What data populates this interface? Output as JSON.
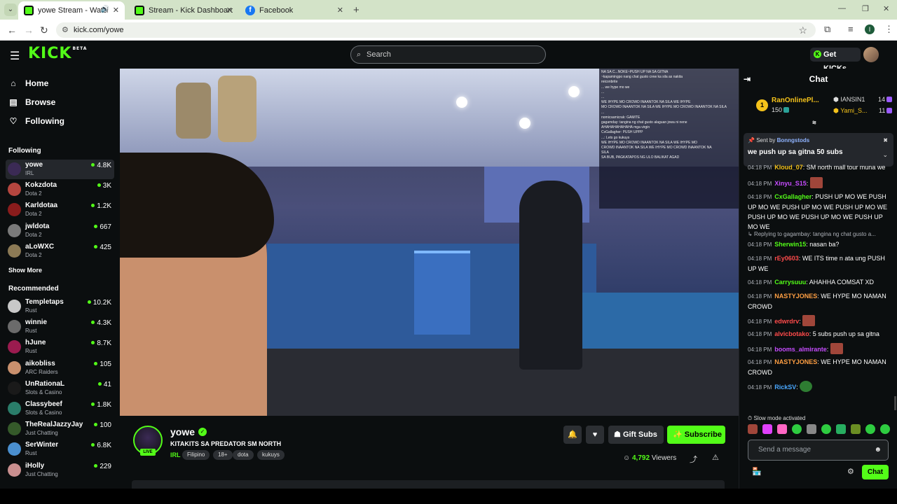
{
  "browser": {
    "tabs": [
      {
        "title": "yowe Stream - Watch Live o",
        "icon": "kick-favicon",
        "active": true
      },
      {
        "title": "Stream - Kick Dashboard",
        "icon": "kick-favicon",
        "active": false
      },
      {
        "title": "Facebook",
        "icon": "facebook-favicon",
        "active": false
      }
    ],
    "url": "kick.com/yowe",
    "profile_initial": "I"
  },
  "header": {
    "logo": "KICK",
    "logo_badge": "BETA",
    "search_placeholder": "Search",
    "get_kicks": "Get KICKs"
  },
  "sidebar": {
    "nav": [
      {
        "label": "Home",
        "icon": "home-icon"
      },
      {
        "label": "Browse",
        "icon": "browse-icon"
      },
      {
        "label": "Following",
        "icon": "heart-icon"
      }
    ],
    "following_title": "Following",
    "following": [
      {
        "name": "yowe",
        "category": "IRL",
        "viewers": "4.8K",
        "color": "#3b2a55"
      },
      {
        "name": "Kokzdota",
        "category": "Dota 2",
        "viewers": "3K",
        "color": "#b5463f"
      },
      {
        "name": "Karldotaa",
        "category": "Dota 2",
        "viewers": "1.2K",
        "color": "#8a1c1c"
      },
      {
        "name": "jwldota",
        "category": "Dota 2",
        "viewers": "667",
        "color": "#7a7a7a"
      },
      {
        "name": "aLoWXC",
        "category": "Dota 2",
        "viewers": "425",
        "color": "#8c7a55"
      }
    ],
    "show_more": "Show More",
    "recommended_title": "Recommended",
    "recommended": [
      {
        "name": "Templetaps",
        "category": "Rust",
        "viewers": "10.2K",
        "color": "#c8c8c8"
      },
      {
        "name": "winnie",
        "category": "Rust",
        "viewers": "4.3K",
        "color": "#6b6b6b"
      },
      {
        "name": "hJune",
        "category": "Rust",
        "viewers": "8.7K",
        "color": "#9b1b4f"
      },
      {
        "name": "aikobliss",
        "category": "ARC Raiders",
        "viewers": "105",
        "color": "#c9906d"
      },
      {
        "name": "UnRationaL",
        "category": "Slots & Casino",
        "viewers": "41",
        "color": "#1a1a1a"
      },
      {
        "name": "Classybeef",
        "category": "Slots & Casino",
        "viewers": "1.8K",
        "color": "#2a7d6a"
      },
      {
        "name": "TheRealJazzyJay",
        "category": "Just Chatting",
        "viewers": "100",
        "color": "#355a2a"
      },
      {
        "name": "SerWinter",
        "category": "Rust",
        "viewers": "6.8K",
        "color": "#4a8fcf"
      },
      {
        "name": "iHolly",
        "category": "Just Chatting",
        "viewers": "229",
        "color": "#c98f8f"
      }
    ]
  },
  "stream": {
    "streamer": "yowe",
    "live_label": "LIVE",
    "title": "KITAKITS SA PREDATOR SM NORTH",
    "category": "IRL",
    "tags": [
      "Filipino",
      "18+",
      "dota",
      "kukuys"
    ],
    "gift_subs": "Gift Subs",
    "subscribe": "Subscribe",
    "viewers_count": "4,792",
    "viewers_label": "Viewers",
    "overlay_lines": [
      "NA SA C...NOKE~PUSH UP NA SA GITNA",
      "~kapamingpo nang chat gusto crew ka sila as nakita",
      "reiconbrite",
      "... we hype mo we",
      "...",
      "...",
      "WE IHYPE MO CROWD INAANTOK NA SILA WE IHYPE",
      "MO CROWD INAANTOK NA SILA WE IHYPE MO CROWD INAANTOK NA SILA",
      "...",
      "nomicsamicrak: GAMITE",
      "gagamday: tangina ng chat gusto alaguan jowa ni nene",
      "AHAHAHAHAHAHA mga virgin",
      "CxGallagher: PUSH UPPP",
      "...: Lets go kukuys",
      "WE IHYPE MO CROWD INAANTOK NA SILA WE IHYPE MO",
      "CROWD INAANTOK NA SILA WE IHYPE MO CROWD INAANTOK NA",
      "SILA",
      "",
      "SA BUB, PAGKATAPOS NG ULO BALIKAT AGAD"
    ]
  },
  "chat": {
    "title": "Chat",
    "leaderboard": [
      {
        "rank": "1",
        "name": "RanOnlinePl...",
        "count": "150"
      },
      {
        "name": "IANSIN1",
        "count": "14"
      },
      {
        "name": "Yami_S...",
        "count": "11"
      }
    ],
    "pinned": {
      "sent_by_label": "Sent by",
      "sender": "Bonngstods",
      "message": "we push up sa gitna 50 subs"
    },
    "messages": [
      {
        "time": "04:18 PM",
        "user": "Kloud_07",
        "color": "#f4c21b",
        "text": "SM north mall tour muna we"
      },
      {
        "time": "04:18 PM",
        "user": "Xinyu_S15",
        "color": "#c64cff",
        "text": ""
      },
      {
        "time": "04:18 PM",
        "user": "CxGallagher",
        "color": "#53fc18",
        "text": "PUSH UP MO WE PUSH UP MO WE PUSH UP MO WE PUSH UP MO WE PUSH UP MO WE PUSH UP MO WE PUSH UP MO WE"
      },
      {
        "reply": "Replying to gagambay: tangina ng chat gusto a..."
      },
      {
        "time": "04:18 PM",
        "user": "Sherwin15",
        "color": "#53fc18",
        "text": "nasan ba?"
      },
      {
        "time": "04:18 PM",
        "user": "rEy0603",
        "color": "#ff4b4b",
        "text": "WE ITS time n ata ung PUSH UP WE"
      },
      {
        "time": "04:18 PM",
        "user": "Carrysuuu",
        "color": "#53fc18",
        "text": "AHAHHA COMSAT XD"
      },
      {
        "time": "04:18 PM",
        "user": "NASTYJONES",
        "color": "#ff9f43",
        "text": "WE HYPE MO NAMAN CROWD"
      },
      {
        "time": "04:18 PM",
        "user": "edwrdrv",
        "color": "#ff4b4b",
        "text": ""
      },
      {
        "time": "04:18 PM",
        "user": "alvicbotako",
        "color": "#ff4b4b",
        "text": "5 subs push up sa gitna"
      },
      {
        "time": "04:18 PM",
        "user": "booms_almirante",
        "color": "#c64cff",
        "text": ""
      },
      {
        "time": "04:18 PM",
        "user": "NASTYJONES",
        "color": "#ff9f43",
        "text": "WE HYPE MO NAMAN CROWD"
      },
      {
        "time": "04:18 PM",
        "user": "RickSV",
        "color": "#4aa8ff",
        "text": ""
      }
    ],
    "slow_mode": "Slow mode activated",
    "input_placeholder": "Send a message",
    "chat_button": "Chat"
  }
}
